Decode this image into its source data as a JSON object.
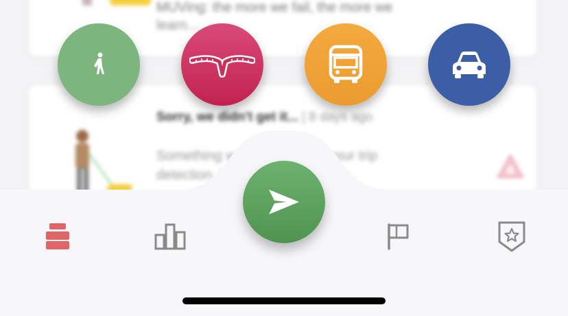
{
  "feed": {
    "card1": {
      "line1": "MUVing: the more we fail, the more we",
      "line2": "learn..."
    },
    "card2": {
      "title": "Sorry, we didn't get it...",
      "time": " | 8 days ago",
      "body1": "Something went wrong with your trip",
      "body2": "detection. Please keep on"
    }
  },
  "modes": [
    {
      "name": "walk",
      "icon": "walking-person-icon",
      "color": "#7db57f"
    },
    {
      "name": "rail",
      "icon": "rail-track-icon",
      "color": "#c9305c"
    },
    {
      "name": "bus",
      "icon": "bus-icon",
      "color": "#f0a33a"
    },
    {
      "name": "car",
      "icon": "car-icon",
      "color": "#3c5ea6"
    }
  ],
  "tabbar": {
    "active_color": "#e06666",
    "inactive_color": "#8a8a8a",
    "tabs": [
      {
        "name": "feed",
        "icon": "stack-icon",
        "active": true
      },
      {
        "name": "stats",
        "icon": "bar-chart-icon",
        "active": false
      },
      {
        "name": "goals",
        "icon": "flag-icon",
        "active": false
      },
      {
        "name": "badges",
        "icon": "shield-star-icon",
        "active": false
      }
    ],
    "center": {
      "name": "send",
      "icon": "paper-plane-icon",
      "color": "#5aa05c"
    }
  }
}
